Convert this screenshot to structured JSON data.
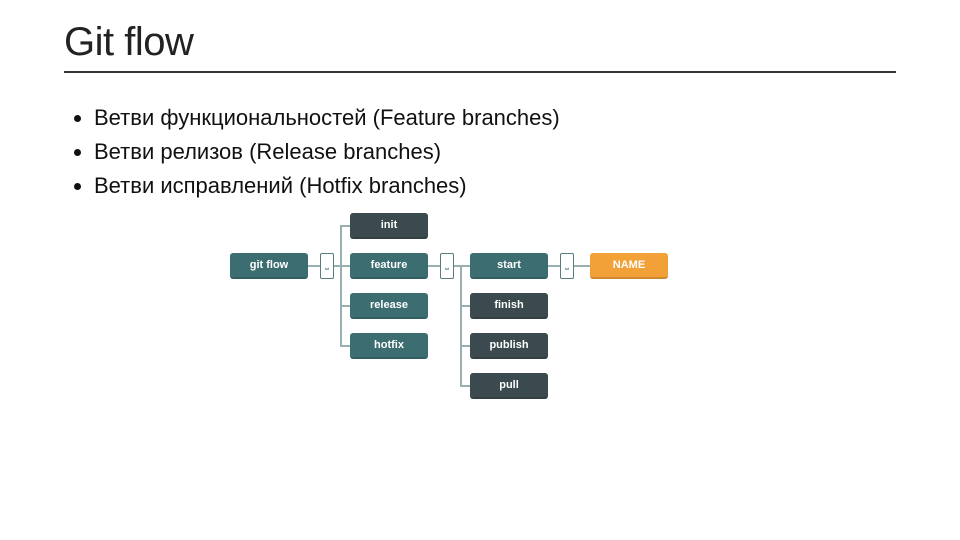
{
  "title": "Git flow",
  "bullets": [
    "Ветви функциональностей (Feature branches)",
    "Ветви релизов (Release branches)",
    "Ветви исправлений (Hotfix branches)"
  ],
  "diagram": {
    "root": "git flow",
    "column2": [
      "init",
      "feature",
      "release",
      "hotfix"
    ],
    "column3": [
      "start",
      "finish",
      "publish",
      "pull"
    ],
    "placeholder": "NAME",
    "space_symbol": "⎵"
  },
  "colors": {
    "teal": "#3c6e71",
    "orange": "#f2a038",
    "charcoal": "#3a4a4f",
    "line": "#99b0b1"
  }
}
